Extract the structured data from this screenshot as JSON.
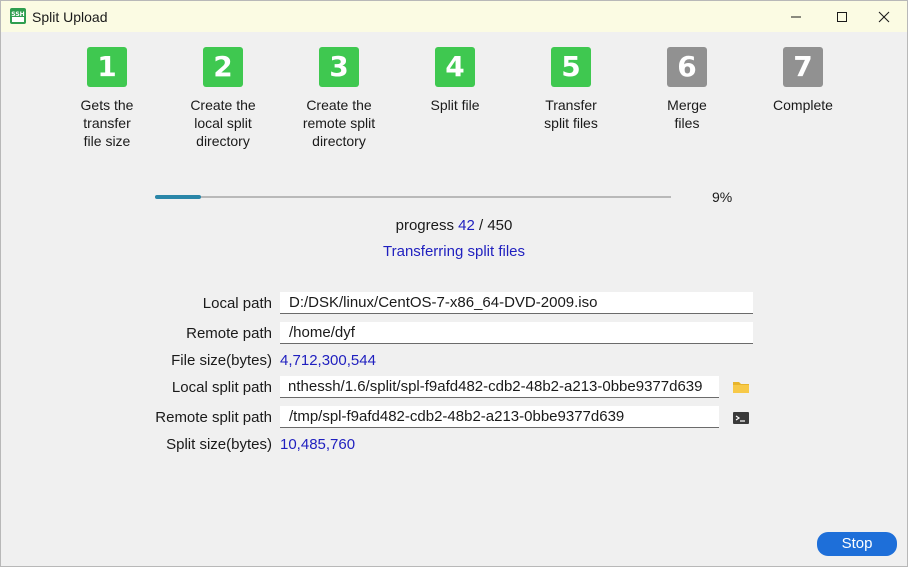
{
  "window": {
    "title": "Split Upload",
    "app_icon_text": "SSH"
  },
  "colors": {
    "done": "#3fc850",
    "pending": "#919191",
    "accent": "#1f1fbf",
    "progress": "#2a86a8",
    "stop": "#1e6fd9"
  },
  "steps": [
    {
      "num": "1",
      "label": "Gets the transfer file size",
      "status": "done"
    },
    {
      "num": "2",
      "label": "Create the local split directory",
      "status": "done"
    },
    {
      "num": "3",
      "label": "Create the remote split directory",
      "status": "done"
    },
    {
      "num": "4",
      "label": "Split file",
      "status": "done"
    },
    {
      "num": "5",
      "label": "Transfer split files",
      "status": "done"
    },
    {
      "num": "6",
      "label": "Merge files",
      "status": "pending"
    },
    {
      "num": "7",
      "label": "Complete",
      "status": "pending"
    }
  ],
  "progress": {
    "percent_value": 9,
    "percent_label": "9%",
    "label": "progress",
    "current": "42",
    "separator": "/",
    "total": "450",
    "status": "Transferring split files"
  },
  "fields": {
    "local_path": {
      "label": "Local path",
      "value": "D:/DSK/linux/CentOS-7-x86_64-DVD-2009.iso"
    },
    "remote_path": {
      "label": "Remote path",
      "value": "/home/dyf"
    },
    "file_size": {
      "label": "File size(bytes)",
      "value": "4,712,300,544"
    },
    "local_split_path": {
      "label": "Local split path",
      "value": "nthessh/1.6/split/spl-f9afd482-cdb2-48b2-a213-0bbe9377d639",
      "icon": "folder-icon"
    },
    "remote_split_path": {
      "label": "Remote split path",
      "value": "/tmp/spl-f9afd482-cdb2-48b2-a213-0bbe9377d639",
      "icon": "terminal-icon"
    },
    "split_size": {
      "label": "Split size(bytes)",
      "value": "10,485,760"
    }
  },
  "buttons": {
    "stop": "Stop"
  }
}
